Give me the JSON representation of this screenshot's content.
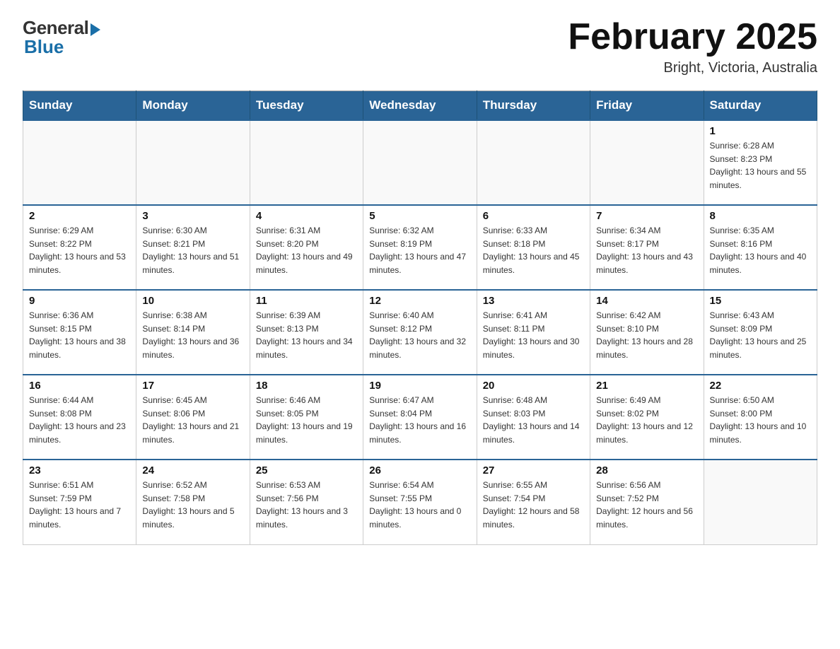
{
  "logo": {
    "general": "General",
    "blue": "Blue"
  },
  "title": "February 2025",
  "subtitle": "Bright, Victoria, Australia",
  "days_of_week": [
    "Sunday",
    "Monday",
    "Tuesday",
    "Wednesday",
    "Thursday",
    "Friday",
    "Saturday"
  ],
  "weeks": [
    [
      {
        "day": "",
        "info": ""
      },
      {
        "day": "",
        "info": ""
      },
      {
        "day": "",
        "info": ""
      },
      {
        "day": "",
        "info": ""
      },
      {
        "day": "",
        "info": ""
      },
      {
        "day": "",
        "info": ""
      },
      {
        "day": "1",
        "info": "Sunrise: 6:28 AM\nSunset: 8:23 PM\nDaylight: 13 hours and 55 minutes."
      }
    ],
    [
      {
        "day": "2",
        "info": "Sunrise: 6:29 AM\nSunset: 8:22 PM\nDaylight: 13 hours and 53 minutes."
      },
      {
        "day": "3",
        "info": "Sunrise: 6:30 AM\nSunset: 8:21 PM\nDaylight: 13 hours and 51 minutes."
      },
      {
        "day": "4",
        "info": "Sunrise: 6:31 AM\nSunset: 8:20 PM\nDaylight: 13 hours and 49 minutes."
      },
      {
        "day": "5",
        "info": "Sunrise: 6:32 AM\nSunset: 8:19 PM\nDaylight: 13 hours and 47 minutes."
      },
      {
        "day": "6",
        "info": "Sunrise: 6:33 AM\nSunset: 8:18 PM\nDaylight: 13 hours and 45 minutes."
      },
      {
        "day": "7",
        "info": "Sunrise: 6:34 AM\nSunset: 8:17 PM\nDaylight: 13 hours and 43 minutes."
      },
      {
        "day": "8",
        "info": "Sunrise: 6:35 AM\nSunset: 8:16 PM\nDaylight: 13 hours and 40 minutes."
      }
    ],
    [
      {
        "day": "9",
        "info": "Sunrise: 6:36 AM\nSunset: 8:15 PM\nDaylight: 13 hours and 38 minutes."
      },
      {
        "day": "10",
        "info": "Sunrise: 6:38 AM\nSunset: 8:14 PM\nDaylight: 13 hours and 36 minutes."
      },
      {
        "day": "11",
        "info": "Sunrise: 6:39 AM\nSunset: 8:13 PM\nDaylight: 13 hours and 34 minutes."
      },
      {
        "day": "12",
        "info": "Sunrise: 6:40 AM\nSunset: 8:12 PM\nDaylight: 13 hours and 32 minutes."
      },
      {
        "day": "13",
        "info": "Sunrise: 6:41 AM\nSunset: 8:11 PM\nDaylight: 13 hours and 30 minutes."
      },
      {
        "day": "14",
        "info": "Sunrise: 6:42 AM\nSunset: 8:10 PM\nDaylight: 13 hours and 28 minutes."
      },
      {
        "day": "15",
        "info": "Sunrise: 6:43 AM\nSunset: 8:09 PM\nDaylight: 13 hours and 25 minutes."
      }
    ],
    [
      {
        "day": "16",
        "info": "Sunrise: 6:44 AM\nSunset: 8:08 PM\nDaylight: 13 hours and 23 minutes."
      },
      {
        "day": "17",
        "info": "Sunrise: 6:45 AM\nSunset: 8:06 PM\nDaylight: 13 hours and 21 minutes."
      },
      {
        "day": "18",
        "info": "Sunrise: 6:46 AM\nSunset: 8:05 PM\nDaylight: 13 hours and 19 minutes."
      },
      {
        "day": "19",
        "info": "Sunrise: 6:47 AM\nSunset: 8:04 PM\nDaylight: 13 hours and 16 minutes."
      },
      {
        "day": "20",
        "info": "Sunrise: 6:48 AM\nSunset: 8:03 PM\nDaylight: 13 hours and 14 minutes."
      },
      {
        "day": "21",
        "info": "Sunrise: 6:49 AM\nSunset: 8:02 PM\nDaylight: 13 hours and 12 minutes."
      },
      {
        "day": "22",
        "info": "Sunrise: 6:50 AM\nSunset: 8:00 PM\nDaylight: 13 hours and 10 minutes."
      }
    ],
    [
      {
        "day": "23",
        "info": "Sunrise: 6:51 AM\nSunset: 7:59 PM\nDaylight: 13 hours and 7 minutes."
      },
      {
        "day": "24",
        "info": "Sunrise: 6:52 AM\nSunset: 7:58 PM\nDaylight: 13 hours and 5 minutes."
      },
      {
        "day": "25",
        "info": "Sunrise: 6:53 AM\nSunset: 7:56 PM\nDaylight: 13 hours and 3 minutes."
      },
      {
        "day": "26",
        "info": "Sunrise: 6:54 AM\nSunset: 7:55 PM\nDaylight: 13 hours and 0 minutes."
      },
      {
        "day": "27",
        "info": "Sunrise: 6:55 AM\nSunset: 7:54 PM\nDaylight: 12 hours and 58 minutes."
      },
      {
        "day": "28",
        "info": "Sunrise: 6:56 AM\nSunset: 7:52 PM\nDaylight: 12 hours and 56 minutes."
      },
      {
        "day": "",
        "info": ""
      }
    ]
  ]
}
